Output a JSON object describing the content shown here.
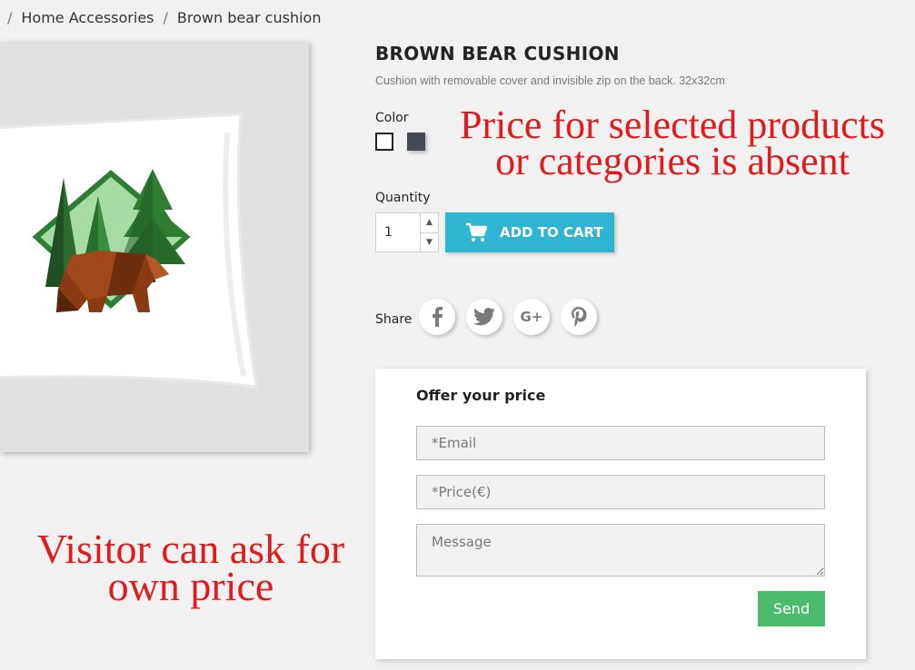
{
  "breadcrumb": {
    "items": [
      "Home Accessories",
      "Brown bear cushion"
    ],
    "separator": "/"
  },
  "product": {
    "title": "BROWN BEAR CUSHION",
    "description": "Cushion with removable cover and invisible zip on the back. 32x32cm",
    "color_label": "Color",
    "colors": [
      {
        "name": "white",
        "hex": "#ffffff",
        "selected": true
      },
      {
        "name": "gray",
        "hex": "#434a54",
        "selected": false
      }
    ],
    "quantity_label": "Quantity",
    "quantity_value": "1",
    "add_to_cart_label": "ADD TO CART"
  },
  "share": {
    "label": "Share",
    "networks": [
      {
        "name": "facebook",
        "icon": "facebook-icon",
        "glyph": "f"
      },
      {
        "name": "twitter",
        "icon": "twitter-icon",
        "glyph": ""
      },
      {
        "name": "google-plus",
        "icon": "google-plus-icon",
        "glyph": "G+"
      },
      {
        "name": "pinterest",
        "icon": "pinterest-icon",
        "glyph": "P"
      }
    ]
  },
  "offer_form": {
    "title": "Offer your price",
    "email_placeholder": "*Email",
    "price_placeholder": "*Price(€)",
    "message_placeholder": "Message",
    "send_label": "Send"
  },
  "annotations": {
    "top_line1": "Price for selected products",
    "top_line2": "or categories is absent",
    "bottom_line1": "Visitor can ask for",
    "bottom_line2": "own price"
  },
  "colors": {
    "accent": "#2fb5d2",
    "send": "#4cbb6c",
    "annotation": "#e01b1b",
    "background": "#f1f1f1"
  }
}
